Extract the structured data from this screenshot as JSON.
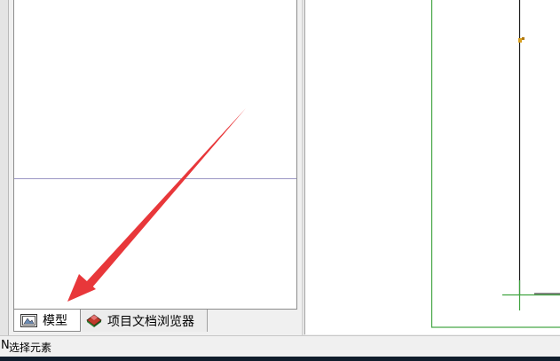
{
  "left_panel": {
    "tabs": [
      {
        "label": "模型",
        "icon": "model-icon",
        "active": true
      },
      {
        "label": "项目文档浏览器",
        "icon": "project-document-browser-icon",
        "active": false
      }
    ]
  },
  "status_bar": {
    "prefix": "N",
    "text": "选择元素"
  },
  "colors": {
    "boundary_green": "#3fa33f",
    "vertical_line": "#1a1a1a",
    "annotation_arrow": "#e8373a"
  }
}
